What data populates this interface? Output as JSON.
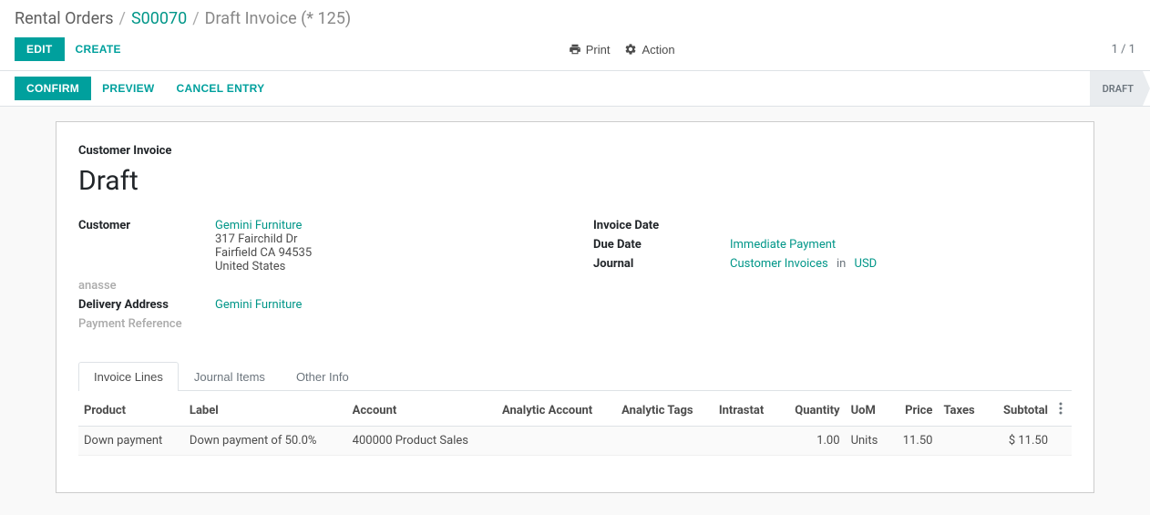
{
  "breadcrumb": {
    "root": "Rental Orders",
    "order": "S00070",
    "current": "Draft Invoice (* 125)"
  },
  "controls": {
    "edit": "EDIT",
    "create": "CREATE",
    "print": "Print",
    "action": "Action",
    "pager": "1 / 1"
  },
  "statusbar": {
    "confirm": "CONFIRM",
    "preview": "PREVIEW",
    "cancel_entry": "CANCEL ENTRY",
    "stage": "DRAFT"
  },
  "header": {
    "doc_type": "Customer Invoice",
    "state": "Draft"
  },
  "left": {
    "customer_label": "Customer",
    "customer_name": "Gemini Furniture",
    "customer_addr1": "317 Fairchild Dr",
    "customer_addr2": "Fairfield CA 94535",
    "customer_addr3": "United States",
    "anasse": "anasse",
    "delivery_label": "Delivery Address",
    "delivery_value": "Gemini Furniture",
    "payref_label": "Payment Reference"
  },
  "right": {
    "invoice_date_label": "Invoice Date",
    "due_date_label": "Due Date",
    "due_date_value": "Immediate Payment",
    "journal_label": "Journal",
    "journal_value": "Customer Invoices",
    "journal_in": "in",
    "journal_currency": "USD"
  },
  "tabs": {
    "lines": "Invoice Lines",
    "journal": "Journal Items",
    "other": "Other Info"
  },
  "table": {
    "headers": {
      "product": "Product",
      "label": "Label",
      "account": "Account",
      "analytic_account": "Analytic Account",
      "analytic_tags": "Analytic Tags",
      "intrastat": "Intrastat",
      "quantity": "Quantity",
      "uom": "UoM",
      "price": "Price",
      "taxes": "Taxes",
      "subtotal": "Subtotal"
    },
    "row": {
      "product": "Down payment",
      "label": "Down payment of 50.0%",
      "account": "400000 Product Sales",
      "quantity": "1.00",
      "uom": "Units",
      "price": "11.50",
      "subtotal": "$ 11.50"
    }
  }
}
